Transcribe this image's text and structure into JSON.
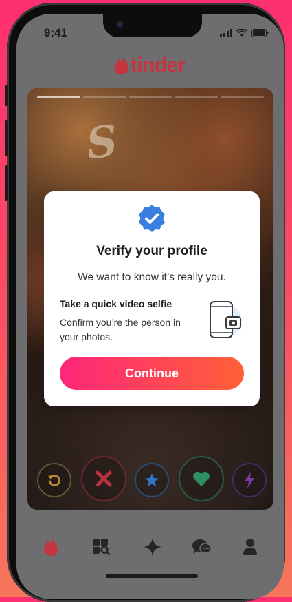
{
  "status_bar": {
    "time": "9:41"
  },
  "app": {
    "brand": "tinder",
    "brand_color": "#c5353f"
  },
  "modal": {
    "title": "Verify your profile",
    "subtitle": "We want to know it’s really you.",
    "section_title": "Take a quick video selfie",
    "section_desc": "Confirm you’re the person in your photos.",
    "cta_label": "Continue",
    "badge_icon": "verified-check-icon",
    "badge_color": "#3a7fe0",
    "cta_gradient": [
      "#fd267a",
      "#ff6036"
    ]
  },
  "profile_card": {
    "photo_count": 5,
    "active_photo": 1
  },
  "action_buttons": [
    {
      "icon": "rewind-icon",
      "color": "#b8892e"
    },
    {
      "icon": "nope-icon",
      "color": "#b8333f"
    },
    {
      "icon": "super-like-icon",
      "color": "#2f78c4"
    },
    {
      "icon": "like-icon",
      "color": "#2e8f63"
    },
    {
      "icon": "boost-icon",
      "color": "#7c3aa8"
    }
  ],
  "tab_bar": [
    {
      "icon": "flame-icon",
      "active": true
    },
    {
      "icon": "explore-icon",
      "active": false
    },
    {
      "icon": "sparkle-icon",
      "active": false
    },
    {
      "icon": "chat-icon",
      "active": false
    },
    {
      "icon": "profile-icon",
      "active": false
    }
  ]
}
